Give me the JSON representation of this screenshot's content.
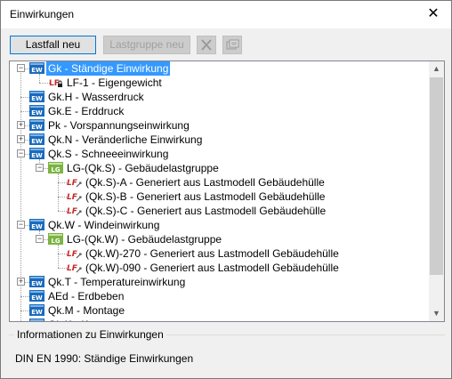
{
  "window": {
    "title": "Einwirkungen"
  },
  "toolbar": {
    "new_case_label": "Lastfall neu",
    "new_group_label": "Lastgruppe neu"
  },
  "colors": {
    "selection": "#3399ff",
    "ew_icon": "#1a6bbd",
    "lg_icon": "#7cb342",
    "lf_icon": "#c62828"
  },
  "tree": {
    "rows": [
      {
        "label": "Gk - Ständige Einwirkung",
        "icon": "ew-icon",
        "level": 0,
        "expander": "minus",
        "selected": true
      },
      {
        "label": "LF-1 - Eigengewicht",
        "icon": "lf-locked-icon",
        "level": 1,
        "expander": ""
      },
      {
        "label": "Gk.H - Wasserdruck",
        "icon": "ew-icon",
        "level": 0,
        "expander": ""
      },
      {
        "label": "Gk.E - Erddruck",
        "icon": "ew-icon",
        "level": 0,
        "expander": ""
      },
      {
        "label": "Pk - Vorspannungseinwirkung",
        "icon": "ew-icon",
        "level": 0,
        "expander": "plus"
      },
      {
        "label": "Qk.N - Veränderliche Einwirkung",
        "icon": "ew-icon",
        "level": 0,
        "expander": "plus"
      },
      {
        "label": "Qk.S - Schneeeinwirkung",
        "icon": "ew-icon",
        "level": 0,
        "expander": "minus"
      },
      {
        "label": "LG-(Qk.S) - Gebäudelastgruppe",
        "icon": "lg-icon",
        "level": 1,
        "expander": "minus"
      },
      {
        "label": "(Qk.S)-A - Generiert aus Lastmodell Gebäudehülle",
        "icon": "lf-generated-icon",
        "level": 2,
        "expander": ""
      },
      {
        "label": "(Qk.S)-B - Generiert aus Lastmodell Gebäudehülle",
        "icon": "lf-generated-icon",
        "level": 2,
        "expander": ""
      },
      {
        "label": "(Qk.S)-C - Generiert aus Lastmodell Gebäudehülle",
        "icon": "lf-generated-icon",
        "level": 2,
        "expander": ""
      },
      {
        "label": "Qk.W - Windeinwirkung",
        "icon": "ew-icon",
        "level": 0,
        "expander": "minus"
      },
      {
        "label": "LG-(Qk.W) - Gebäudelastgruppe",
        "icon": "lg-icon",
        "level": 1,
        "expander": "minus"
      },
      {
        "label": "(Qk.W)-270 - Generiert aus Lastmodell Gebäudehülle",
        "icon": "lf-generated-icon",
        "level": 2,
        "expander": ""
      },
      {
        "label": "(Qk.W)-090 - Generiert aus Lastmodell Gebäudehülle",
        "icon": "lf-generated-icon",
        "level": 2,
        "expander": ""
      },
      {
        "label": "Qk.T - Temperatureinwirkung",
        "icon": "ew-icon",
        "level": 0,
        "expander": "plus"
      },
      {
        "label": "AEd - Erdbeben",
        "icon": "ew-icon",
        "level": 0,
        "expander": ""
      },
      {
        "label": "Qk.M - Montage",
        "icon": "ew-icon",
        "level": 0,
        "expander": ""
      },
      {
        "label": "Qk.K - Kran",
        "icon": "ew-icon",
        "level": 0,
        "expander": ""
      }
    ]
  },
  "info": {
    "title": "Informationen zu Einwirkungen",
    "text": "DIN EN 1990: Ständige Einwirkungen"
  }
}
